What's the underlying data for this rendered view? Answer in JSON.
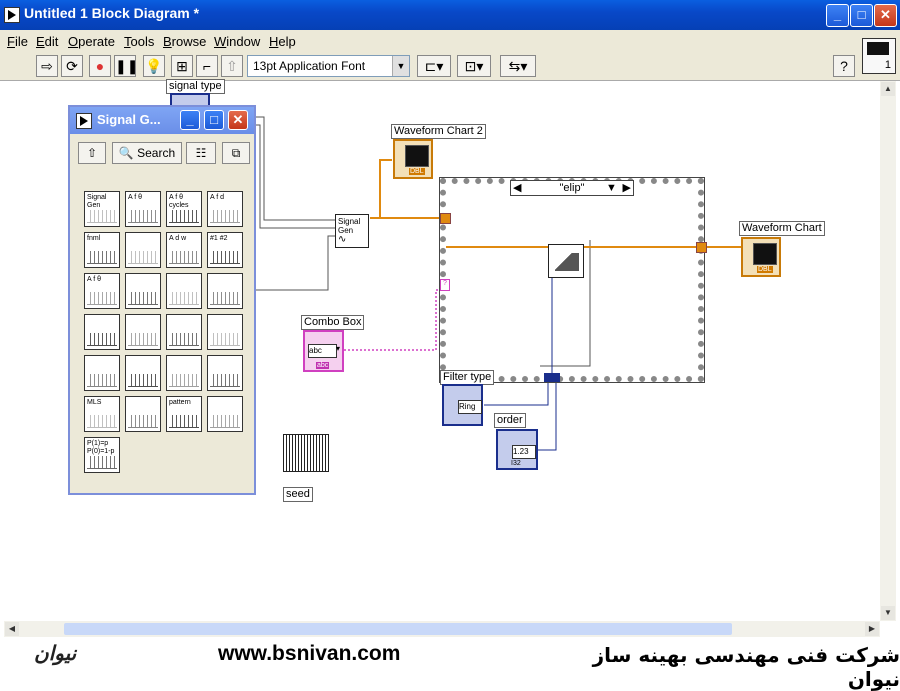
{
  "window": {
    "title": "Untitled 1 Block Diagram *",
    "buttons": [
      "minimize",
      "maximize",
      "close"
    ]
  },
  "menu": [
    "File",
    "Edit",
    "Operate",
    "Tools",
    "Browse",
    "Window",
    "Help"
  ],
  "toolbar": {
    "font": "13pt Application Font",
    "context_help_value": "1"
  },
  "palette": {
    "title": "Signal G...",
    "search_label": "Search",
    "icon_captions": [
      "Signal Gen",
      "A f θ",
      "A f θ cycles",
      "A f d",
      "fnml",
      "",
      "A d w",
      "#1 #2",
      "A f θ",
      "",
      "",
      "",
      "",
      "",
      "",
      "",
      "",
      "",
      "",
      "",
      "MLS",
      "",
      "pattern",
      "",
      "P(1)=p P(0)=1-p"
    ]
  },
  "diagram": {
    "signal_type_label": "signal type",
    "waveform_chart2_label": "Waveform Chart 2",
    "waveform_chart_label": "Waveform Chart",
    "combo_box_label": "Combo Box",
    "combo_value": "abc",
    "combo_type": "abc",
    "case_selector": "\"elip\"",
    "filter_type_label": "Filter type",
    "filter_value": "Ring",
    "order_label": "order",
    "order_value": "1.23",
    "order_type": "I32",
    "seed_label": "seed",
    "signal_gen_node": "Signal Gen",
    "dbl_tag": "DBL"
  },
  "banner": {
    "url": "www.bsnivan.com",
    "company": "شرکت فنی مهندسی بهینه ساز نیوان",
    "logo": "نیوان"
  },
  "colors": {
    "titlebar": "#0848c8",
    "orange_wire": "#e08a10",
    "pink_wire": "#d040c0",
    "blue_terminal": "#1a2e8c"
  }
}
